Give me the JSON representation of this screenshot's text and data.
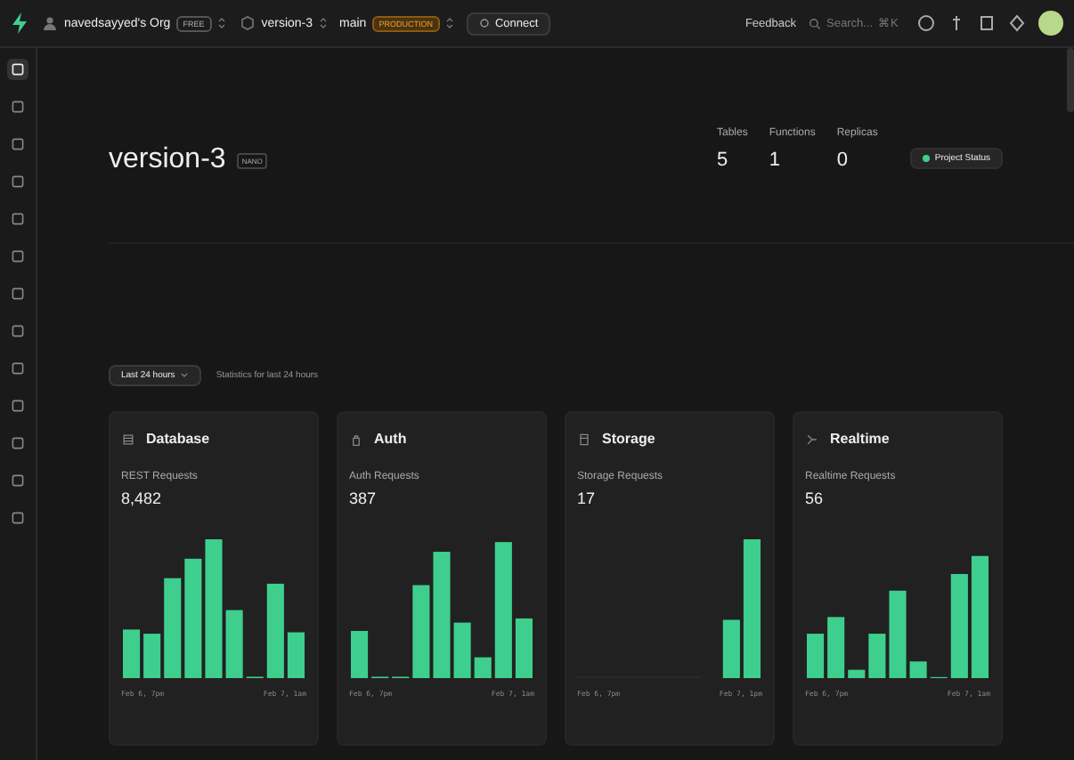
{
  "topbar": {
    "org": {
      "name": "navedsayyed's Org",
      "plan": "FREE"
    },
    "project": "version-3",
    "branch": {
      "name": "main",
      "env": "PRODUCTION"
    },
    "connect": "Connect",
    "feedback": "Feedback",
    "search": {
      "placeholder": "Search...",
      "shortcut": "⌘K"
    }
  },
  "sidebar": {
    "items": [
      {
        "selected": true
      },
      {
        "selected": false
      },
      {
        "selected": false
      },
      {
        "selected": false
      },
      {
        "selected": false
      },
      {
        "selected": false
      },
      {
        "selected": false
      },
      {
        "selected": false
      },
      {
        "selected": false
      },
      {
        "selected": false
      },
      {
        "selected": false
      },
      {
        "selected": false
      },
      {
        "selected": false
      }
    ]
  },
  "header": {
    "title": "version-3",
    "badge": "NANO",
    "stats": [
      {
        "label": "Tables",
        "value": "5"
      },
      {
        "label": "Functions",
        "value": "1"
      },
      {
        "label": "Replicas",
        "value": "0"
      }
    ],
    "status_button": "Project Status"
  },
  "filter": {
    "range": "Last 24 hours",
    "caption": "Statistics for last 24 hours"
  },
  "cards": [
    {
      "title": "Database",
      "metric": "REST Requests",
      "value": "8,482",
      "x_start": "Feb 6, 7pm",
      "x_end": "Feb 7, 1am"
    },
    {
      "title": "Auth",
      "metric": "Auth Requests",
      "value": "387",
      "x_start": "Feb 6, 7pm",
      "x_end": "Feb 7, 1am"
    },
    {
      "title": "Storage",
      "metric": "Storage Requests",
      "value": "17",
      "x_start": "Feb 6, 7pm",
      "x_end": "Feb 7, 1pm"
    },
    {
      "title": "Realtime",
      "metric": "Realtime Requests",
      "value": "56",
      "x_start": "Feb 6, 7pm",
      "x_end": "Feb 7, 1am"
    }
  ]
}
